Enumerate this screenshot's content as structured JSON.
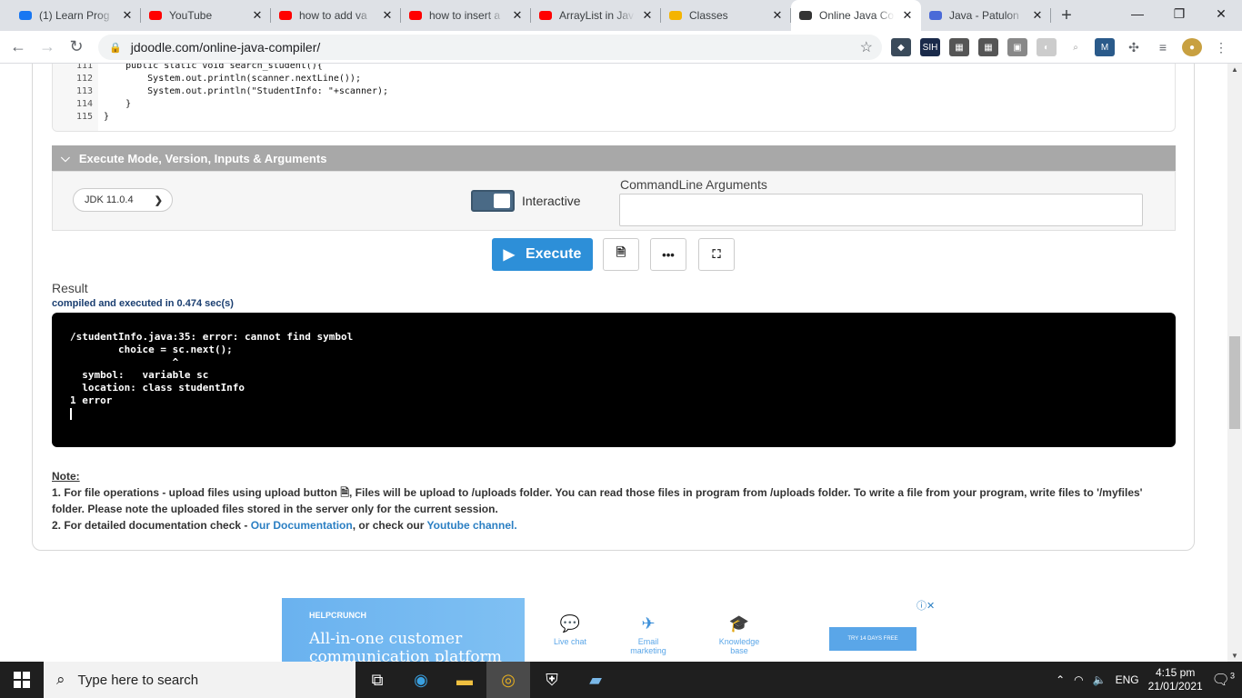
{
  "tabs": [
    {
      "title": "(1) Learn Prog",
      "icon": "facebook-icon",
      "color": "#1877f2",
      "active": false
    },
    {
      "title": "YouTube",
      "icon": "youtube-icon",
      "color": "#ff0000",
      "active": false
    },
    {
      "title": "how to add va",
      "icon": "youtube-icon",
      "color": "#ff0000",
      "active": false
    },
    {
      "title": "how to insert a",
      "icon": "youtube-icon",
      "color": "#ff0000",
      "active": false
    },
    {
      "title": "ArrayList in Jav",
      "icon": "youtube-icon",
      "color": "#ff0000",
      "active": false
    },
    {
      "title": "Classes",
      "icon": "classroom-icon",
      "color": "#f4b400",
      "active": false
    },
    {
      "title": "Online Java Co",
      "icon": "jdoodle-icon",
      "color": "#333333",
      "active": true
    },
    {
      "title": "Java - Patulon",
      "icon": "patulong-icon",
      "color": "#4a6ad8",
      "active": false
    }
  ],
  "address": {
    "url": "jdoodle.com/online-java-compiler/"
  },
  "code": {
    "line_numbers": [
      "111",
      "112",
      "113",
      "114",
      "115"
    ],
    "lines": [
      "    public static void search_student(){",
      "        System.out.println(scanner.nextLine());",
      "        System.out.println(\"StudentInfo: \"+scanner);",
      "    }",
      "}"
    ]
  },
  "execute_panel": {
    "header": "Execute Mode, Version, Inputs & Arguments",
    "jdk_version": "JDK 11.0.4",
    "interactive_label": "Interactive",
    "interactive_on": true,
    "cmdline_label": "CommandLine Arguments",
    "cmdline_value": ""
  },
  "buttons": {
    "execute": "Execute",
    "more": "•••"
  },
  "result": {
    "label": "Result",
    "compiled": "compiled and executed in 0.474 sec(s)",
    "output": "/studentInfo.java:35: error: cannot find symbol\n        choice = sc.next();\n                 ^\n  symbol:   variable sc\n  location: class studentInfo\n1 error\n"
  },
  "note": {
    "title": "Note:",
    "item1_a": "1. For file operations - upload files using upload button ",
    "item1_b": ", Files will be upload to /uploads folder. You can read those files in program from /uploads folder. To write a file from your program, write files to '/myfiles' folder. Please note the uploaded files stored in the server only for the current session.",
    "item2_a": "2. For detailed documentation check - ",
    "item2_link1": "Our Documentation",
    "item2_b": ", or check our ",
    "item2_link2": "Youtube channel."
  },
  "ad": {
    "brand": "HELPCRUNCH",
    "headline": "All-in-one customer communication platform",
    "options": [
      "Live chat",
      "Email marketing",
      "Knowledge base"
    ],
    "cta": "TRY 14 DAYS FREE"
  },
  "taskbar": {
    "search_placeholder": "Type here to search",
    "lang": "ENG",
    "time": "4:15 pm",
    "date": "21/01/2021",
    "notifications": "3"
  }
}
